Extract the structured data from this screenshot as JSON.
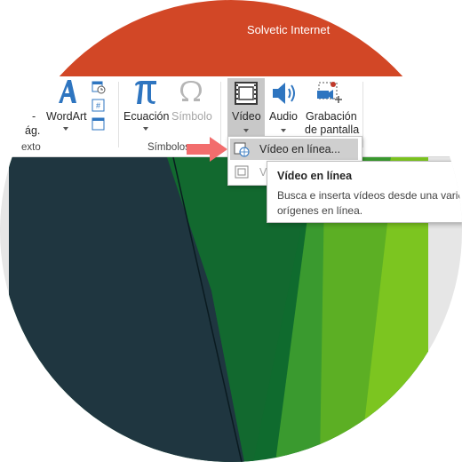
{
  "app": {
    "title": "Solvetic Internet"
  },
  "ribbon": {
    "partial_left_top": "-",
    "partial_left_bottom": "ág.",
    "wordart": "WordArt",
    "texto_group": "exto",
    "equation": "Ecuación",
    "symbol": "Símbolo",
    "symbols_group": "Símbolos",
    "video": "Vídeo",
    "audio": "Audio",
    "screen_recording_line1": "Grabación",
    "screen_recording_line2": "de pantalla"
  },
  "dropdown": {
    "items": [
      {
        "label": "Vídeo en línea..."
      },
      {
        "label": "Ví"
      }
    ]
  },
  "tooltip": {
    "title": "Vídeo en línea",
    "text": "Busca e inserta vídeos desde una varie orígenes en línea."
  },
  "colors": {
    "titlebar": "#d24726",
    "arrow": "#f26d6d",
    "slide_dark": "#1f3640",
    "slide_green_dark": "#0f6b2e",
    "slide_green_mid": "#3a9a2f",
    "slide_green_light": "#7cc520"
  }
}
